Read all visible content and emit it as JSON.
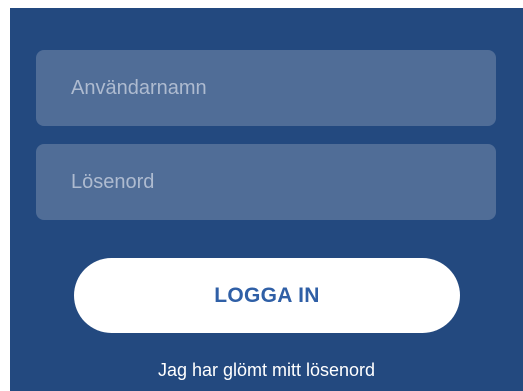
{
  "login": {
    "username_placeholder": "Användarnamn",
    "password_placeholder": "Lösenord",
    "username_value": "",
    "password_value": "",
    "login_button_label": "LOGGA IN",
    "forgot_password_link": "Jag har glömt mitt lösenord"
  },
  "colors": {
    "background": "#23497f",
    "field_background": "#506d97",
    "placeholder_text": "#aebbd0",
    "button_background": "#ffffff",
    "button_text": "#2f5fa6",
    "link_text": "#ffffff"
  }
}
